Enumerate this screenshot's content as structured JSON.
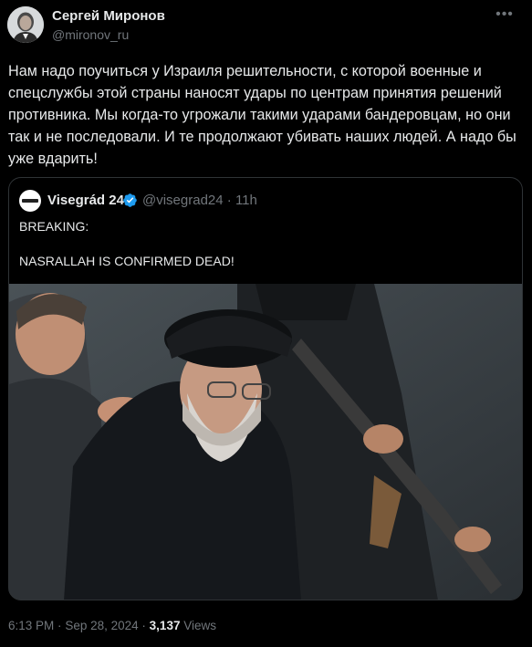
{
  "author": {
    "name": "Сергей Миронов",
    "handle": "@mironov_ru",
    "avatar_icon": "portrait-avatar"
  },
  "more_icon": "ellipsis-icon",
  "tweet_text": "Нам надо поучиться у Израиля решительности, с которой военные и спецслужбы этой страны наносят удары по центрам принятия решений противника. Мы когда-то угрожали такими ударами бандеровцам, но они так и не последовали. И те продолжают убивать наших людей. А надо бы уже вдарить!",
  "quoted": {
    "name": "Visegrád 24",
    "handle": "@visegrad24",
    "separator": "·",
    "time": "11h",
    "verified_icon": "verified-badge-icon",
    "verified_color": "#1d9bf0",
    "text_lines": [
      "BREAKING:",
      "",
      "NASRALLAH IS CONFIRMED DEAD!"
    ],
    "media_icon": "photo-image"
  },
  "meta": {
    "time": "6:13 PM",
    "separator": "·",
    "date": "Sep 28, 2024",
    "views_count": "3,137",
    "views_label": "Views"
  },
  "colors": {
    "background": "#000000",
    "text": "#e7e9ea",
    "secondary": "#71767b",
    "border": "#2f3336"
  }
}
